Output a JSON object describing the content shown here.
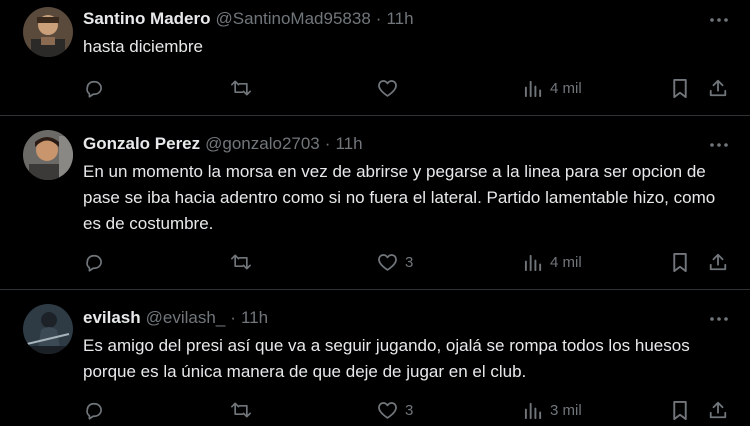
{
  "tweets": [
    {
      "name": "Santino Madero",
      "handle": "@SantinoMad95838",
      "separator": "·",
      "time": "11h",
      "text": "hasta diciembre",
      "replies": "",
      "retweets": "",
      "likes": "",
      "views": "4 mil"
    },
    {
      "name": "Gonzalo Perez",
      "handle": "@gonzalo2703",
      "separator": "·",
      "time": "11h",
      "text": "En un momento la morsa en vez de abrirse y pegarse a la linea para ser opcion de pase se iba hacia adentro como si no fuera el lateral. Partido lamentable hizo, como es de costumbre.",
      "replies": "",
      "retweets": "",
      "likes": "3",
      "views": "4 mil"
    },
    {
      "name": "evilash",
      "handle": "@evilash_",
      "separator": "·",
      "time": "11h",
      "text": "Es amigo del presi así que va a seguir jugando, ojalá se rompa todos los huesos porque es la única manera de que deje de jugar en el club.",
      "replies": "",
      "retweets": "",
      "likes": "3",
      "views": "3 mil"
    }
  ],
  "icons": [
    "reply-icon",
    "retweet-icon",
    "like-icon",
    "views-icon",
    "bookmark-icon",
    "share-icon",
    "more-icon"
  ],
  "colors": {
    "background": "#000000",
    "text": "#e7e9ea",
    "muted": "#71767b",
    "divider": "#2f3336"
  }
}
